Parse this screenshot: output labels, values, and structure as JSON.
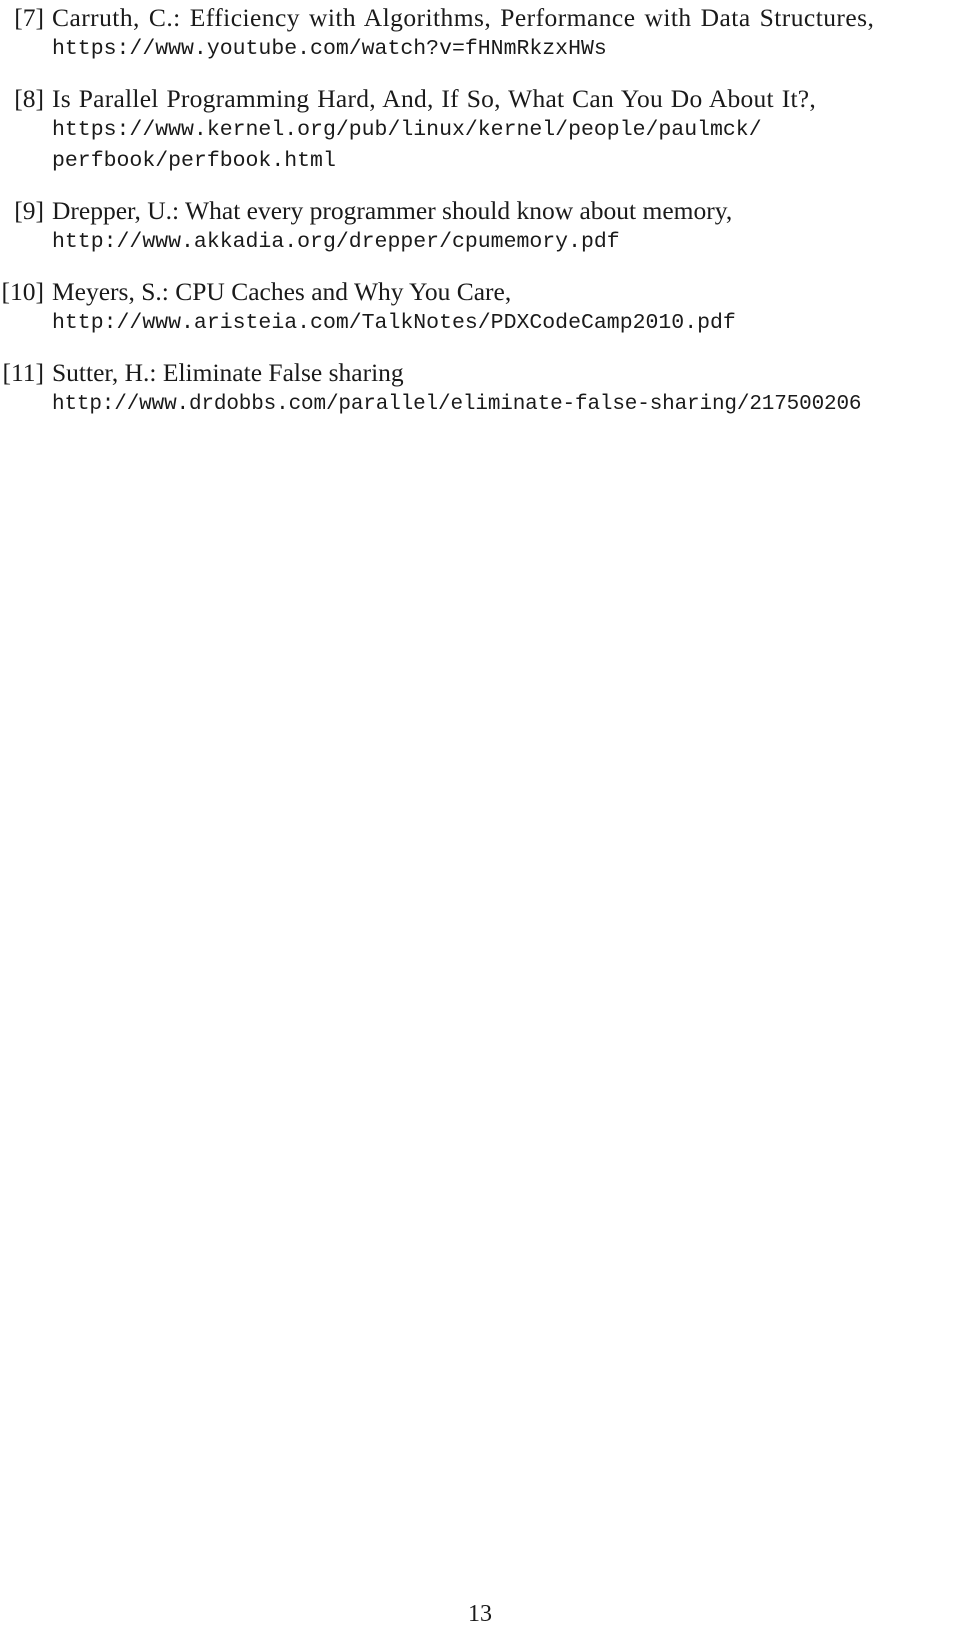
{
  "document": {
    "type": "bibliography",
    "page_number": "13",
    "text_color": "#1a1a1a",
    "background_color": "#ffffff"
  },
  "references": [
    {
      "label": "[7]",
      "title": "Carruth, C.: Efficiency with Algorithms, Performance with Data Structures,",
      "urls": [
        "https://www.youtube.com/watch?v=fHNmRkzxHWs"
      ]
    },
    {
      "label": "[8]",
      "title": "Is Parallel Programming Hard, And, If So, What Can You Do About It?,",
      "urls": [
        "https://www.kernel.org/pub/linux/kernel/people/paulmck/",
        "perfbook/perfbook.html"
      ]
    },
    {
      "label": "[9]",
      "title": "Drepper, U.: What every programmer should know about memory,",
      "urls": [
        "http://www.akkadia.org/drepper/cpumemory.pdf"
      ]
    },
    {
      "label": "[10]",
      "title": "Meyers, S.: CPU Caches and Why You Care,",
      "urls": [
        "http://www.aristeia.com/TalkNotes/PDXCodeCamp2010.pdf"
      ]
    },
    {
      "label": "[11]",
      "title": "Sutter, H.: Eliminate False sharing",
      "urls": [
        "http://www.drdobbs.com/parallel/eliminate-false-sharing/217500206"
      ]
    }
  ]
}
